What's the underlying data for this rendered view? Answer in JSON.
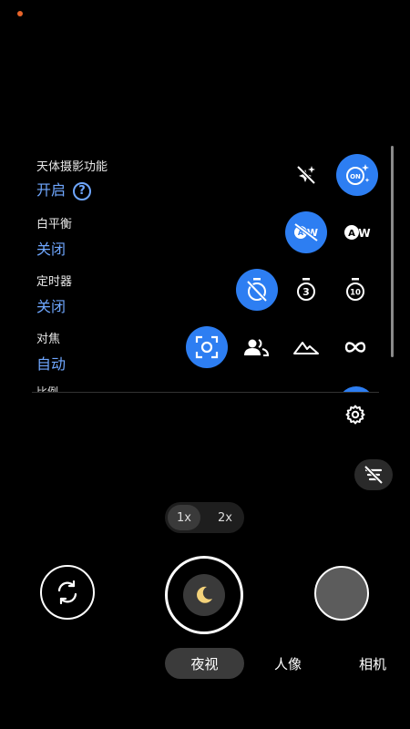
{
  "settings": {
    "rows": [
      {
        "label": "天体摄影功能",
        "value": "开启"
      },
      {
        "label": "白平衡",
        "value": "关闭"
      },
      {
        "label": "定时器",
        "value": "关闭"
      },
      {
        "label": "对焦",
        "value": "自动"
      },
      {
        "label": "比例"
      }
    ],
    "help": "?",
    "awb_text": "AW",
    "astro_on_text": "ON",
    "timer3": "3",
    "timer10": "10"
  },
  "zoom": {
    "options": [
      "1x",
      "2x"
    ],
    "selected": "1x"
  },
  "modes": {
    "items": [
      "夜视",
      "人像",
      "相机"
    ],
    "active": "夜视"
  },
  "colors": {
    "accent": "#2d7ef2",
    "value_text": "#6fa7ff",
    "background": "#000000",
    "status_dot": "#e8642a"
  },
  "icons": [
    "astro-off-icon",
    "astro-on-icon",
    "awb-off-icon",
    "awb-icon",
    "timer-off-icon",
    "timer-3s-icon",
    "timer-10s-icon",
    "focus-auto-icon",
    "focus-portrait-icon",
    "focus-landscape-icon",
    "focus-infinity-icon",
    "gear-icon",
    "motion-off-icon",
    "switch-camera-icon",
    "moon-icon"
  ]
}
